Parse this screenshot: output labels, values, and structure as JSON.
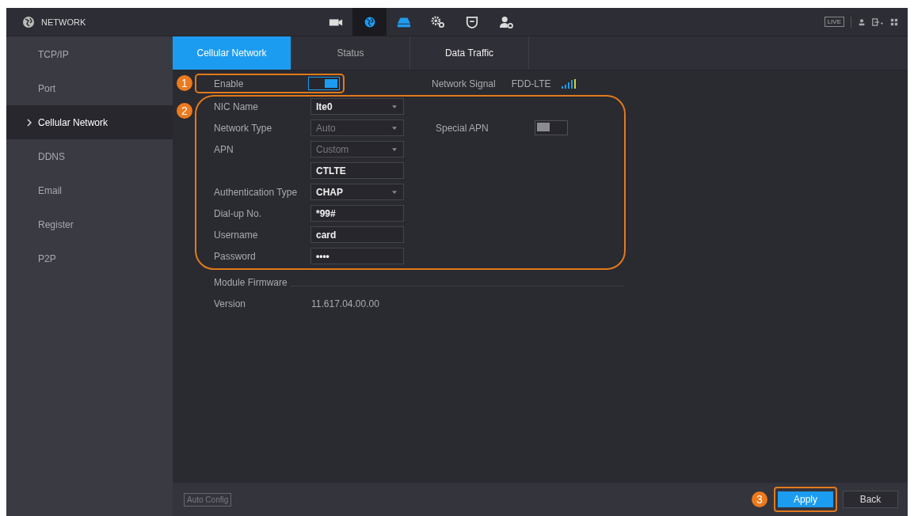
{
  "header": {
    "title": "NETWORK",
    "toolbar": [
      {
        "kind": "camera",
        "selected": false
      },
      {
        "kind": "globe",
        "selected": true
      },
      {
        "kind": "storage",
        "selected": false
      },
      {
        "kind": "gears",
        "selected": false
      },
      {
        "kind": "shield",
        "selected": false
      },
      {
        "kind": "user-gear",
        "selected": false
      }
    ],
    "live": "LIVE"
  },
  "sidebar": {
    "items": [
      {
        "label": "TCP/IP",
        "selected": false
      },
      {
        "label": "Port",
        "selected": false
      },
      {
        "label": "Cellular Network",
        "selected": true
      },
      {
        "label": "DDNS",
        "selected": false
      },
      {
        "label": "Email",
        "selected": false
      },
      {
        "label": "Register",
        "selected": false
      },
      {
        "label": "P2P",
        "selected": false
      }
    ]
  },
  "tabs": [
    {
      "label": "Cellular Network",
      "selected": true
    },
    {
      "label": "Status",
      "selected": false
    },
    {
      "label": "Data Traffic",
      "selected": false
    }
  ],
  "enable": {
    "label": "Enable",
    "on": true,
    "callout": "1"
  },
  "signal": {
    "label": "Network Signal",
    "value": "FDD-LTE"
  },
  "settings": {
    "callout": "2",
    "fields": [
      {
        "label": "NIC Name",
        "kind": "select",
        "value": "lte0",
        "disabled": false
      },
      {
        "label": "Network Type",
        "kind": "select",
        "value": "Auto",
        "disabled": true
      },
      {
        "label": "APN",
        "kind": "select",
        "value": "Custom",
        "disabled": true
      },
      {
        "kind": "text",
        "value": "CTLTE",
        "disabled": false
      },
      {
        "label": "Authentication Type",
        "kind": "select",
        "value": "CHAP",
        "disabled": false
      },
      {
        "label": "Dial-up No.",
        "kind": "text",
        "value": "*99#",
        "disabled": false
      },
      {
        "label": "Username",
        "kind": "text",
        "value": "card",
        "disabled": false
      },
      {
        "label": "Password",
        "kind": "password",
        "value": "••••",
        "disabled": false
      }
    ],
    "special_apn": {
      "label": "Special APN",
      "on": false
    }
  },
  "firmware": {
    "title": "Module Firmware",
    "label": "Version",
    "value": "11.617.04.00.00"
  },
  "footer": {
    "auto_config": {
      "label": "Auto Config",
      "disabled": true
    },
    "apply": {
      "label": "Apply",
      "callout": "3"
    },
    "back": "Back"
  }
}
